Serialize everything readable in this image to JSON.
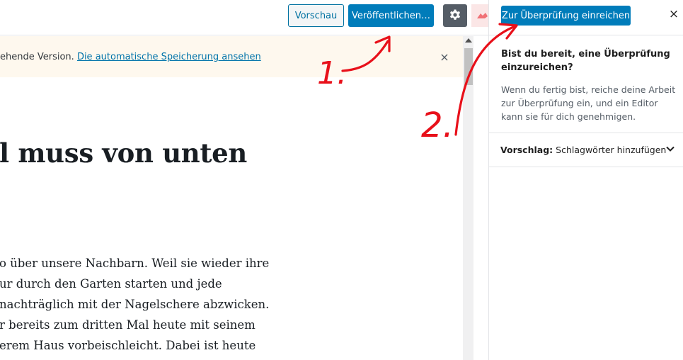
{
  "toolbar": {
    "preview_label": "Vorschau",
    "publish_label": "Veröffentlichen…",
    "settings_icon": "gear-icon",
    "plugin_icon": "jetpack-icon"
  },
  "notice": {
    "text": "ehende Version. ",
    "link": "Die automatische Speicherung ansehen",
    "close_icon": "×"
  },
  "editor": {
    "title": "l muss von unten",
    "paragraph_lines": [
      "o über unsere Nachbarn. Weil sie wieder ihre",
      "ur durch den Garten starten und jede",
      "nachträglich mit der Nagelschere abzwicken.",
      "r bereits zum dritten Mal heute mit seinem",
      "erem Haus vorbeischleicht. Dabei ist heute"
    ]
  },
  "sidebar": {
    "submit_label": "Zur Überprüfung einreichen",
    "close_icon": "×",
    "heading": "Bist du bereit, eine Überprüfung einzureichen?",
    "description": "Wenn du fertig bist, reiche deine Arbeit zur Überprüfung ein, und ein Editor kann sie für dich genehmigen.",
    "panel_label_bold": "Vorschlag:",
    "panel_label_rest": " Schlagwörter hinzufügen"
  },
  "annotations": {
    "step1": "1.",
    "step2": "2.",
    "color": "#e8101a"
  },
  "colors": {
    "primary": "#007cba",
    "secondary_button": "#555d66",
    "notice_bg": "#fef8ee",
    "link": "#0073aa"
  }
}
